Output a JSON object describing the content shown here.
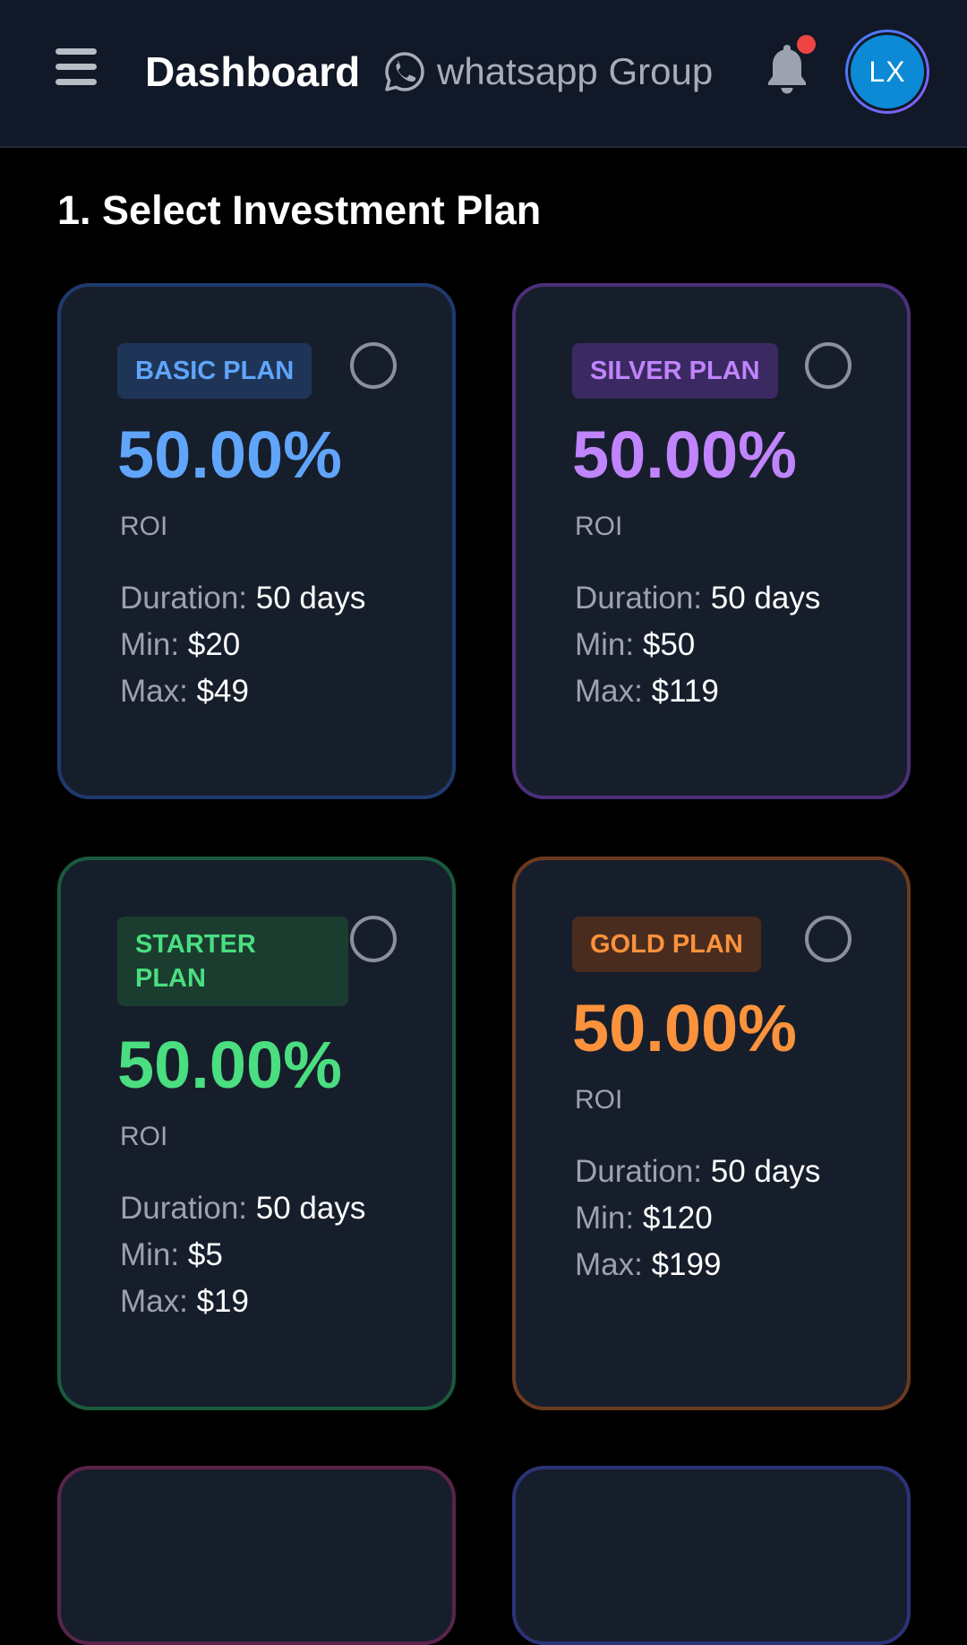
{
  "header": {
    "title": "Dashboard",
    "whatsapp_label": "whatsapp Group",
    "avatar_initials": "LX",
    "notification_dot_color": "#ef4444"
  },
  "section": {
    "title": "1. Select Investment Plan"
  },
  "plans": [
    {
      "name": "BASIC PLAN",
      "roi": "50.00%",
      "roi_label": "ROI",
      "duration_label": "Duration:",
      "duration": "50 days",
      "min_label": "Min:",
      "min": "$20",
      "max_label": "Max:",
      "max": "$49",
      "accent": "#60a5fa",
      "selected": false
    },
    {
      "name": "SILVER PLAN",
      "roi": "50.00%",
      "roi_label": "ROI",
      "duration_label": "Duration:",
      "duration": "50 days",
      "min_label": "Min:",
      "min": "$50",
      "max_label": "Max:",
      "max": "$119",
      "accent": "#c084fc",
      "selected": false
    },
    {
      "name": "STARTER PLAN",
      "roi": "50.00%",
      "roi_label": "ROI",
      "duration_label": "Duration:",
      "duration": "50 days",
      "min_label": "Min:",
      "min": "$5",
      "max_label": "Max:",
      "max": "$19",
      "accent": "#4ade80",
      "selected": false
    },
    {
      "name": "GOLD PLAN",
      "roi": "50.00%",
      "roi_label": "ROI",
      "duration_label": "Duration:",
      "duration": "50 days",
      "min_label": "Min:",
      "min": "$120",
      "max_label": "Max:",
      "max": "$199",
      "accent": "#fb923c",
      "selected": false
    }
  ],
  "icons": {
    "menu": "hamburger-menu-icon",
    "whatsapp": "whatsapp-icon",
    "bell": "bell-icon"
  }
}
